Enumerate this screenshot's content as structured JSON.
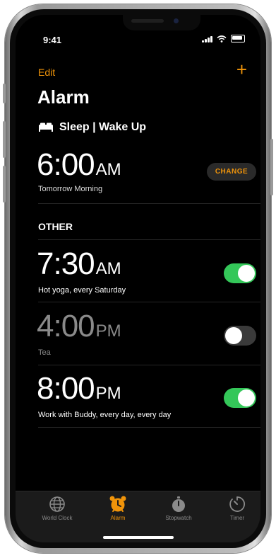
{
  "status_bar": {
    "time": "9:41"
  },
  "nav": {
    "edit_label": "Edit",
    "add_label": "+"
  },
  "page": {
    "title": "Alarm"
  },
  "sleep": {
    "header": "Sleep | Wake Up",
    "time": "6:00",
    "ampm": "AM",
    "subtitle": "Tomorrow Morning",
    "change_label": "CHANGE"
  },
  "other_header": "OTHER",
  "alarms": [
    {
      "time": "7:30",
      "ampm": "AM",
      "label": "Hot yoga, every Saturday",
      "enabled": true
    },
    {
      "time": "4:00",
      "ampm": "PM",
      "label": "Tea",
      "enabled": false
    },
    {
      "time": "8:00",
      "ampm": "PM",
      "label": "Work with Buddy, every day, every day",
      "enabled": true
    }
  ],
  "tabs": [
    {
      "label": "World Clock",
      "icon": "globe-icon",
      "active": false
    },
    {
      "label": "Alarm",
      "icon": "alarm-clock-icon",
      "active": true
    },
    {
      "label": "Stopwatch",
      "icon": "stopwatch-icon",
      "active": false
    },
    {
      "label": "Timer",
      "icon": "timer-icon",
      "active": false
    }
  ],
  "colors": {
    "accent": "#f0940a",
    "toggle_on": "#34c759",
    "background": "#000000"
  }
}
